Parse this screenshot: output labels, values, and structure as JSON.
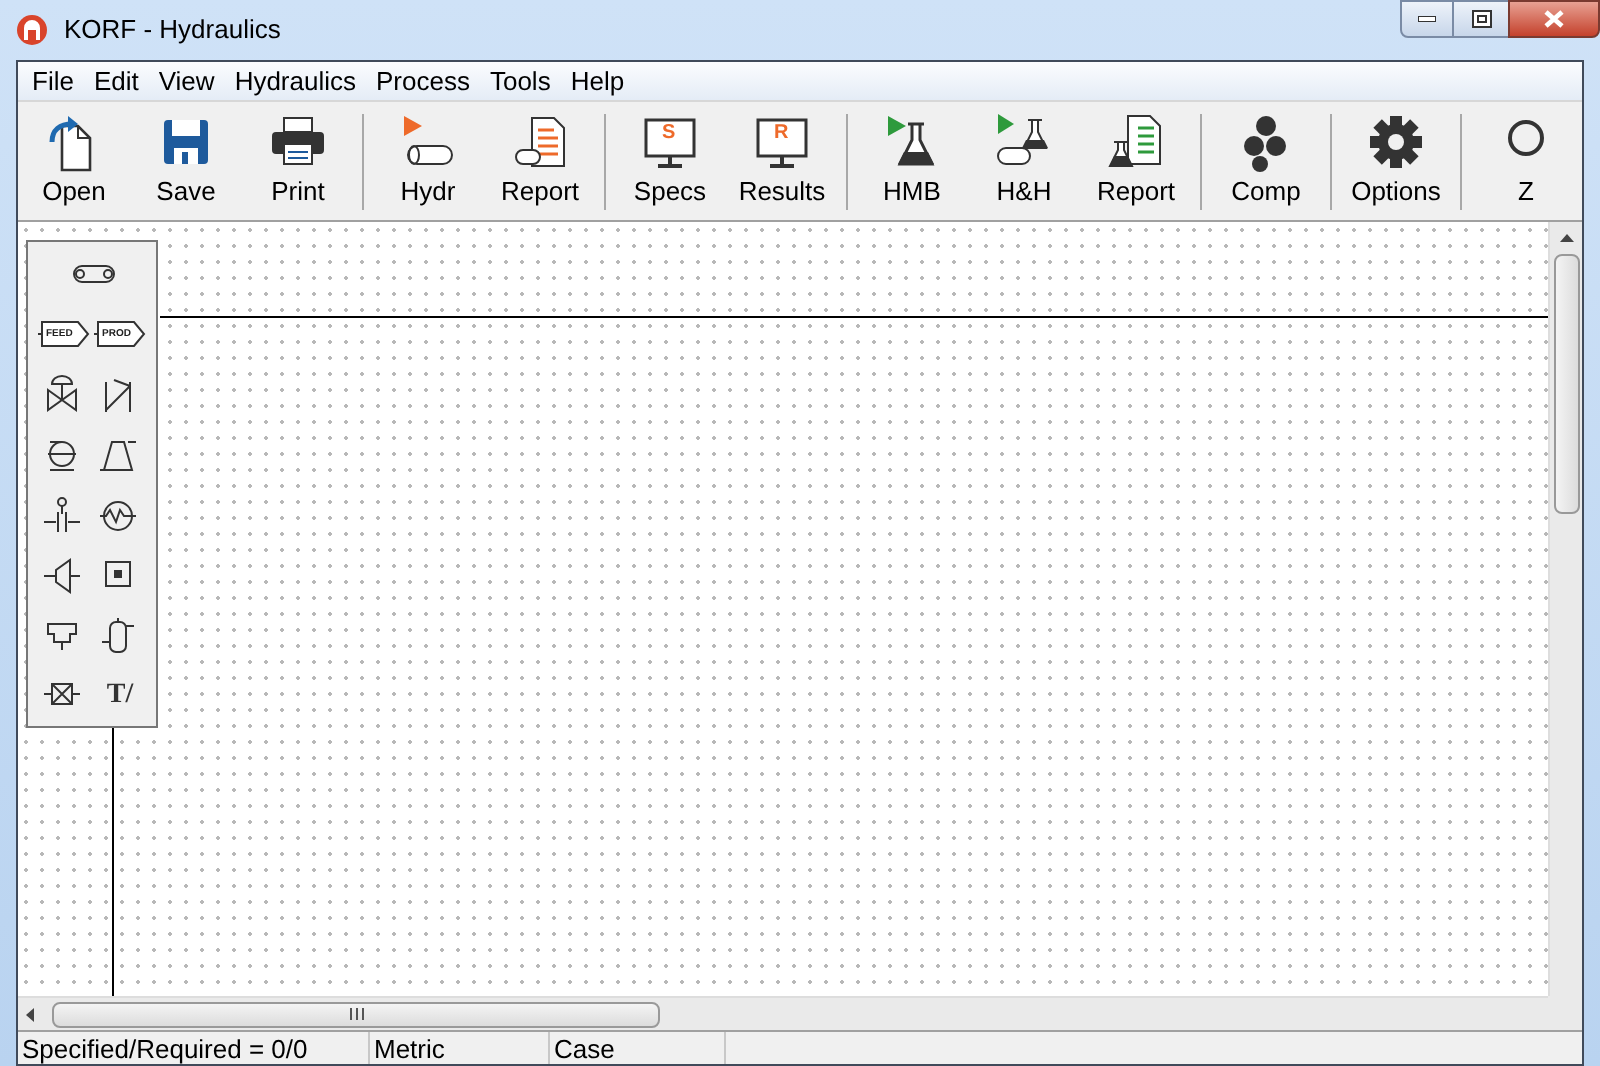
{
  "window": {
    "title": "KORF - Hydraulics"
  },
  "menu": [
    "File",
    "Edit",
    "View",
    "Hydraulics",
    "Process",
    "Tools",
    "Help"
  ],
  "toolbar": [
    [
      {
        "label": "Open",
        "kind": "open"
      },
      {
        "label": "Save",
        "kind": "save"
      },
      {
        "label": "Print",
        "kind": "print"
      }
    ],
    [
      {
        "label": "Hydr",
        "kind": "hydr"
      },
      {
        "label": "Report",
        "kind": "report"
      }
    ],
    [
      {
        "label": "Specs",
        "kind": "monitor",
        "badge": "S"
      },
      {
        "label": "Results",
        "kind": "monitor",
        "badge": "R"
      }
    ],
    [
      {
        "label": "HMB",
        "kind": "hmb"
      },
      {
        "label": "H&H",
        "kind": "hh"
      },
      {
        "label": "Report",
        "kind": "report2"
      }
    ],
    [
      {
        "label": "Comp",
        "kind": "comp"
      }
    ],
    [
      {
        "label": "Options",
        "kind": "gear"
      }
    ],
    [
      {
        "label": "Z",
        "kind": "zoom"
      }
    ]
  ],
  "palette": [
    {
      "kind": "pipe"
    },
    {
      "kind": "feed",
      "text": "FEED"
    },
    {
      "kind": "feed",
      "text": "PROD"
    },
    {
      "kind": "valve"
    },
    {
      "kind": "check"
    },
    {
      "kind": "pump"
    },
    {
      "kind": "compressor"
    },
    {
      "kind": "orifice"
    },
    {
      "kind": "exchanger"
    },
    {
      "kind": "nozzle"
    },
    {
      "kind": "block"
    },
    {
      "kind": "tee"
    },
    {
      "kind": "vessel"
    },
    {
      "kind": "misc"
    },
    {
      "kind": "text",
      "text": "T/"
    }
  ],
  "status_bar": [
    "Specified/Required = 0/0",
    "Metric",
    "Case"
  ]
}
